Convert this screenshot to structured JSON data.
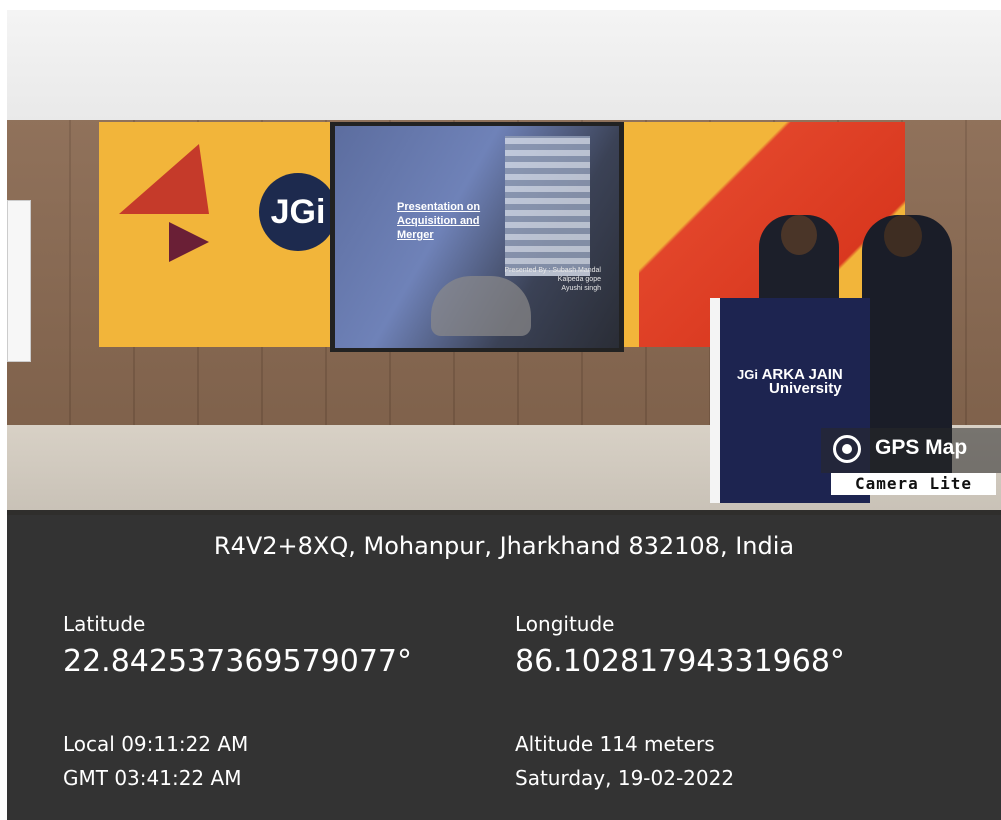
{
  "photo": {
    "banner_logo": "JGi",
    "slide": {
      "title": "Presentation on Acquisition and Merger",
      "names": [
        "Presented By : Subash Mandal",
        "Kalpeda gope",
        "Ayushi singh"
      ]
    },
    "podium": {
      "logo": "JGi",
      "line1": "ARKA JAIN",
      "line2": "University"
    }
  },
  "badge": {
    "title": "GPS Map",
    "subtitle": "Camera Lite",
    "icon": "camera-icon"
  },
  "location": {
    "address": "R4V2+8XQ, Mohanpur, Jharkhand 832108, India",
    "latitude_label": "Latitude",
    "latitude_value": "22.842537369579077°",
    "longitude_label": "Longitude",
    "longitude_value": "86.10281794331968°",
    "local_time": "Local 09:11:22 AM",
    "gmt_time": "GMT 03:41:22 AM",
    "altitude": "Altitude 114 meters",
    "date": "Saturday, 19-02-2022"
  }
}
